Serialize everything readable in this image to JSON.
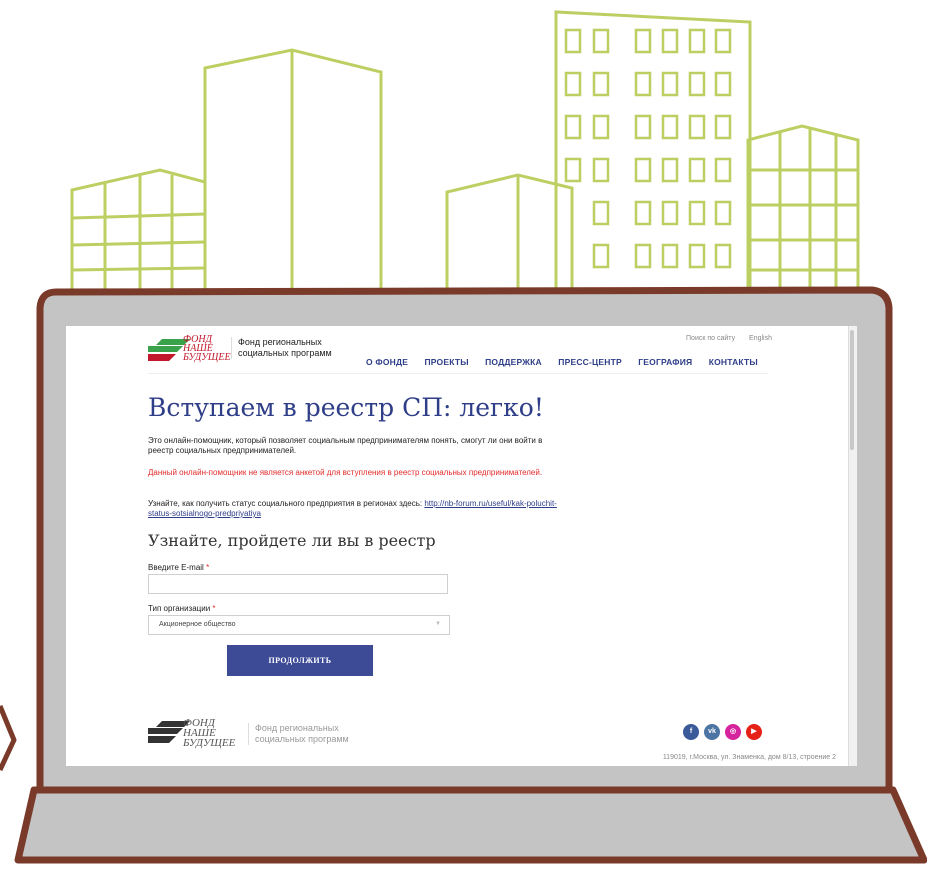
{
  "colors": {
    "brand_blue": "#2f3e88",
    "button_blue": "#3d4b96",
    "warning_red": "#e32b2b",
    "logo_red": "#c2182b",
    "logo_green": "#3aa24a",
    "building_green": "#bccf62",
    "laptop_brown": "#7a3a2a"
  },
  "header": {
    "logo_lines": [
      "ФОНД",
      "НАШЕ",
      "БУДУЩЕЕ"
    ],
    "org_lines": [
      "Фонд региональных",
      "социальных программ"
    ],
    "search_link": "Поиск по сайту",
    "lang_link": "English",
    "nav": [
      "О ФОНДЕ",
      "ПРОЕКТЫ",
      "ПОДДЕРЖКА",
      "ПРЕСС-ЦЕНТР",
      "ГЕОГРАФИЯ",
      "КОНТАКТЫ"
    ]
  },
  "main": {
    "title": "Вступаем в реестр СП: легко!",
    "intro": "Это онлайн-помощник, который позволяет социальным предпринимателям понять, смогут ли они войти в реестр социальных предпринимателей.",
    "warning": "Данный онлайн-помощник не является анкетой для вступления в реестр социальных предпринимателей.",
    "status_text": "Узнайте, как получить статус социального предприятия в регионах здесь:",
    "status_link": "http://nb-forum.ru/useful/kak-poluchit-status-sotsialnogo-predpriyatiya",
    "subtitle": "Узнайте, пройдете ли вы в реестр"
  },
  "form": {
    "email_label": "Введите E-mail",
    "email_value": "",
    "org_type_label": "Тип организации",
    "required_mark": "*",
    "org_type_selected": "Акционерное общество",
    "submit_label": "ПРОДОЛЖИТЬ"
  },
  "footer": {
    "logo_lines": [
      "ФОНД",
      "НАШЕ",
      "БУДУЩЕЕ"
    ],
    "org_lines": [
      "Фонд региональных",
      "социальных программ"
    ],
    "social_icons": [
      "facebook-icon",
      "vk-icon",
      "instagram-icon",
      "youtube-icon"
    ],
    "address": "119019, г.Москва, ул. Знаменка, дом 8/13, строение 2"
  }
}
